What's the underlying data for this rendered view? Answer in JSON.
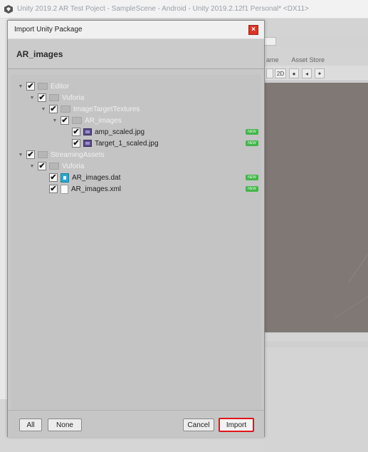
{
  "window": {
    "title": "Unity 2019.2 AR Test Poject - SampleScene - Android - Unity 2019.2.12f1 Personal* <DX11>"
  },
  "dialog": {
    "title": "Import Unity Package",
    "close_glyph": "×",
    "package_name": "AR_images",
    "tree": [
      {
        "label": "Editor",
        "level": 0,
        "checked": true,
        "icon": "folder-icon"
      },
      {
        "label": "Vuforia",
        "level": 1,
        "checked": true,
        "icon": "folder-icon"
      },
      {
        "label": "ImageTargetTextures",
        "level": 2,
        "checked": true,
        "icon": "folder-icon"
      },
      {
        "label": "AR_images",
        "level": 3,
        "checked": true,
        "icon": "folder-icon"
      },
      {
        "label": "amp_scaled.jpg",
        "level": 4,
        "checked": true,
        "icon": "image-file-icon",
        "new": true
      },
      {
        "label": "Target_1_scaled.jpg",
        "level": 4,
        "checked": true,
        "icon": "image-file-icon",
        "new": true
      },
      {
        "label": "StreamingAssets",
        "level": 0,
        "checked": true,
        "icon": "folder-icon"
      },
      {
        "label": "Vuforia",
        "level": 1,
        "checked": true,
        "icon": "folder-icon"
      },
      {
        "label": "AR_images.dat",
        "level": 2,
        "checked": true,
        "icon": "data-file-icon",
        "new": true
      },
      {
        "label": "AR_images.xml",
        "level": 2,
        "checked": true,
        "icon": "xml-file-icon",
        "new": true
      }
    ],
    "new_badge": "NEW",
    "buttons": {
      "all": "All",
      "none": "None",
      "cancel": "Cancel",
      "import": "Import"
    }
  },
  "background": {
    "tabs": [
      "ame",
      "Asset Store"
    ],
    "toolbar": [
      "2D"
    ]
  },
  "colors": {
    "import_highlight": "#e3141c",
    "close_button": "#d9352a",
    "new_badge": "#43b54a"
  }
}
